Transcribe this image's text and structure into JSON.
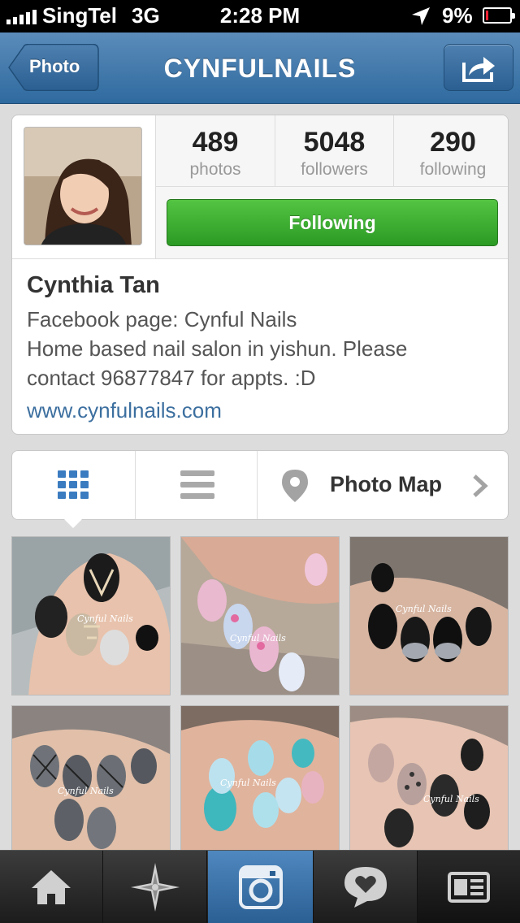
{
  "status_bar": {
    "carrier": "SingTel",
    "network": "3G",
    "time": "2:28 PM",
    "battery": "9%",
    "battery_level": 0.09
  },
  "nav": {
    "title": "CYNFULNAILS",
    "back_label": "Photo",
    "share_icon": "share-icon"
  },
  "profile": {
    "stats": [
      {
        "value": "489",
        "label": "photos"
      },
      {
        "value": "5048",
        "label": "followers"
      },
      {
        "value": "290",
        "label": "following"
      }
    ],
    "follow_button": "Following",
    "name": "Cynthia Tan",
    "bio": [
      "Facebook page: Cynful Nails",
      "Home based nail salon in yishun. Please",
      "contact 96877847 for appts. :D"
    ],
    "website": "www.cynfulnails.com"
  },
  "view_tabs": {
    "grid_icon": "grid-view-icon",
    "list_icon": "list-view-icon",
    "map_label": "Photo Map"
  },
  "photos": [
    {
      "name": "photo-1",
      "watermark": "Cynful Nails"
    },
    {
      "name": "photo-2",
      "watermark": "Cynful Nails"
    },
    {
      "name": "photo-3",
      "watermark": "Cynful Nails"
    },
    {
      "name": "photo-4",
      "watermark": "Cynful Nails"
    },
    {
      "name": "photo-5",
      "watermark": "Cynful Nails"
    },
    {
      "name": "photo-6",
      "watermark": "Cynful Nails"
    }
  ],
  "bottom_bar": [
    "home-icon",
    "explore-icon",
    "camera-icon",
    "activity-icon",
    "news-icon"
  ],
  "colors": {
    "nav_blue": "#3d75a8",
    "follow_green": "#3aad30",
    "link_blue": "#3c6f9f",
    "grid_icon_blue": "#3b7cc0"
  }
}
